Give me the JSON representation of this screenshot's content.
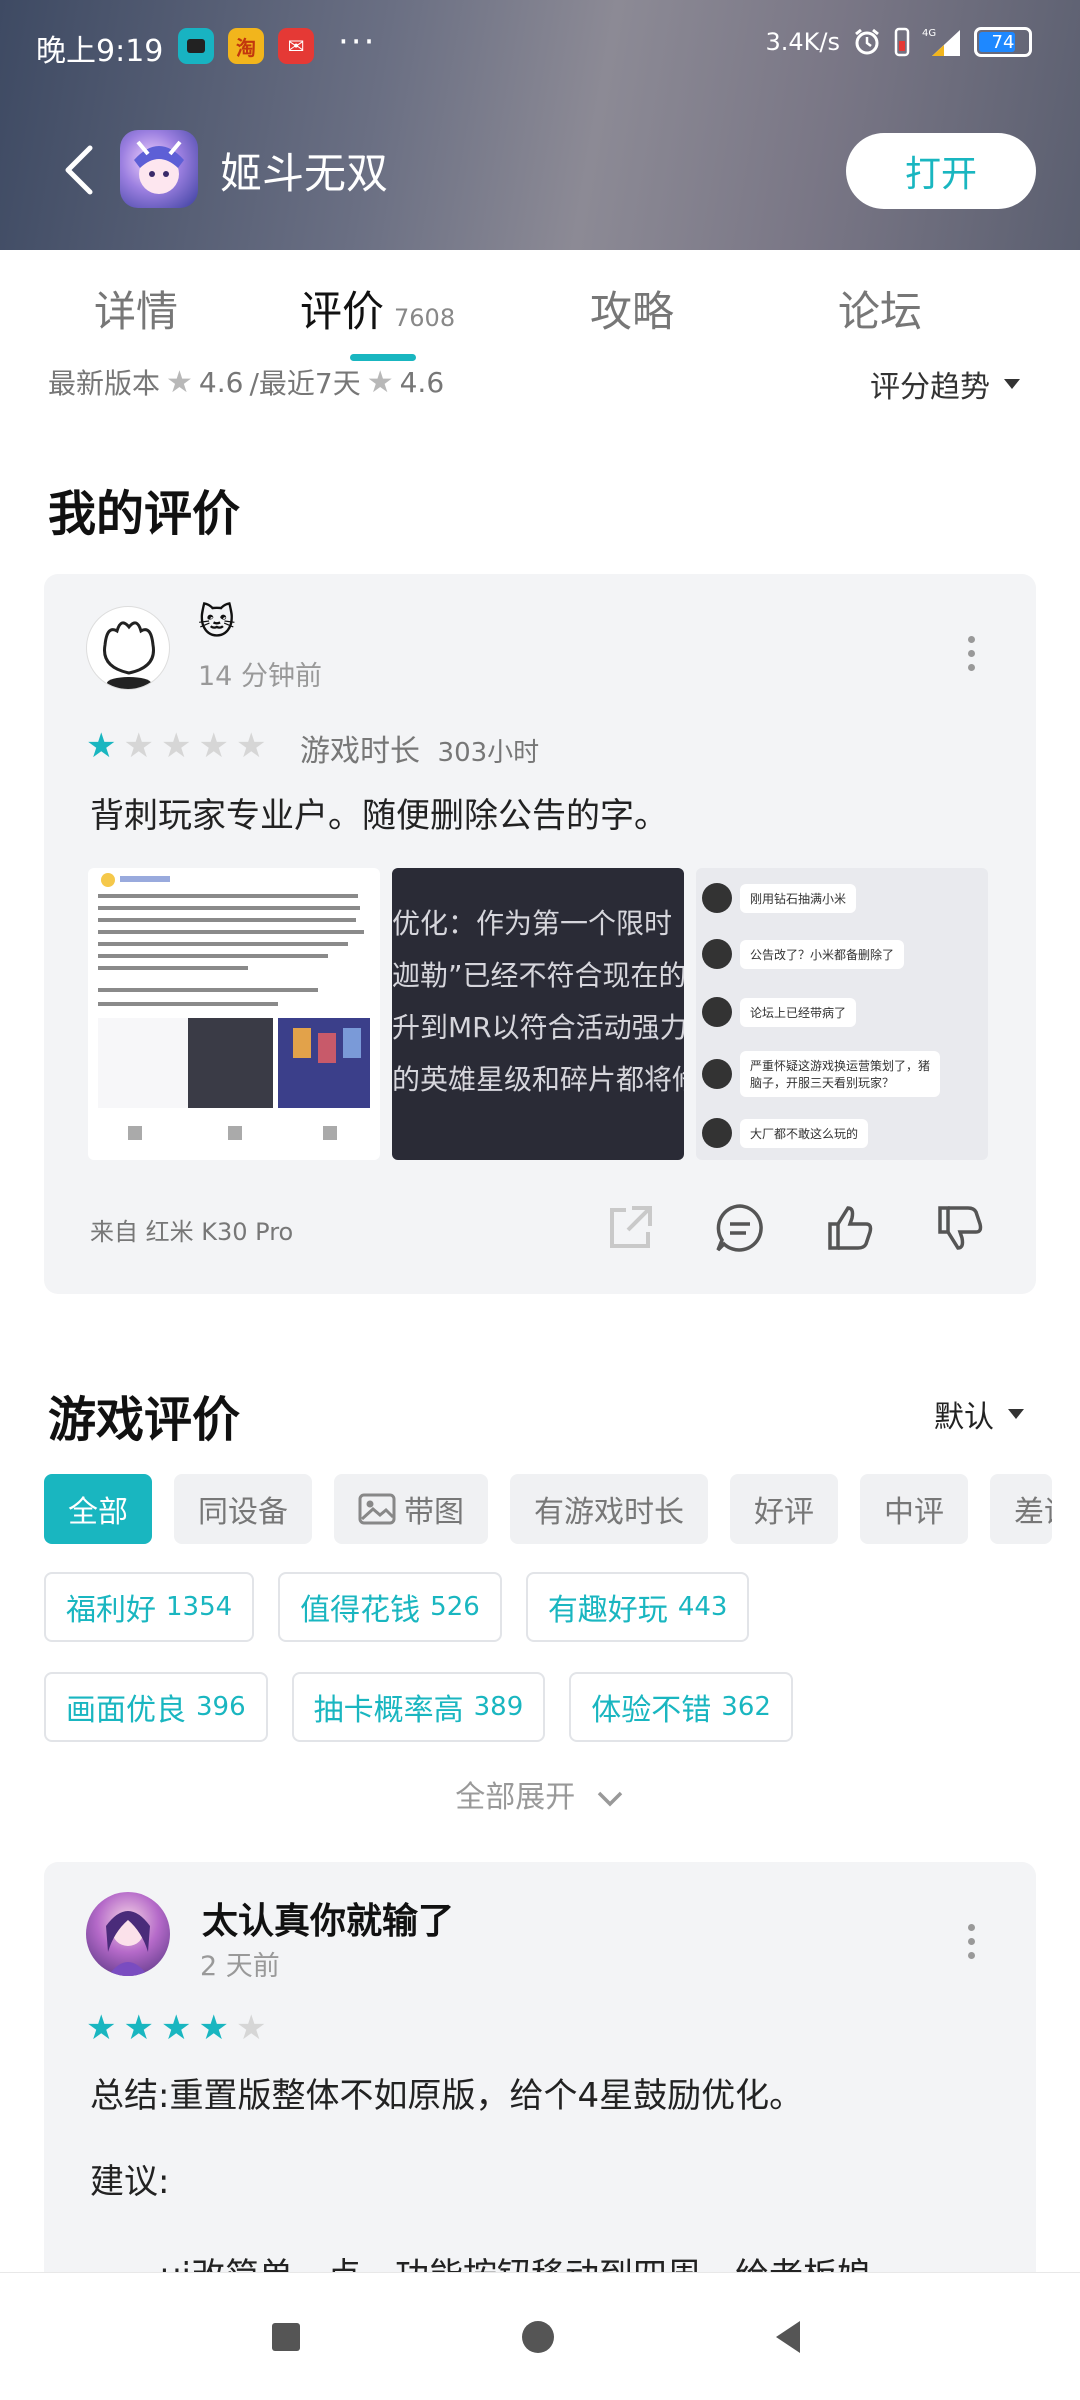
{
  "status": {
    "time": "晚上9:19",
    "apps": [
      {
        "icon": "chat-app-icon",
        "color": "#18b3c2",
        "glyph": "▣"
      },
      {
        "icon": "taobao-app-icon",
        "color": "#f2b51c",
        "glyph": "淘"
      },
      {
        "icon": "mail-app-icon",
        "color": "#e53935",
        "glyph": "✉"
      }
    ],
    "more": "···",
    "speed": "3.4K/s",
    "battery": "74"
  },
  "app": {
    "name": "姬斗无双",
    "open_label": "打开"
  },
  "tabs": [
    {
      "label": "详情",
      "count": ""
    },
    {
      "label": "评价",
      "count": "7608"
    },
    {
      "label": "攻略",
      "count": ""
    },
    {
      "label": "论坛",
      "count": ""
    }
  ],
  "rating": {
    "latest_label": "最新版本",
    "latest_score": "4.6",
    "recent_label": "/最近7天",
    "recent_score": "4.6",
    "trend_label": "评分趋势"
  },
  "my_review": {
    "section_title": "我的评价",
    "user_name": "🐱",
    "time_ago": "14 分钟前",
    "stars": 1,
    "playtime_label": "游戏时长",
    "playtime_value": "303小时",
    "text": "背刺玩家专业户。随便删除公告的字。",
    "thumb2_lines": [
      "优化：作为第一个限时",
      "迦勒”已经不符合现在的版",
      "升到MR以符合活动强力",
      "的英雄星级和碎片都将修"
    ],
    "thumb3_lines": [
      "刚用钻石抽满小米",
      "公告改了？小米都备删除了",
      "论坛上已经带病了",
      "严重怀疑这游戏换运营策划了，猪脑子，开服三天看别玩家？",
      "大厂都不敢这么玩的"
    ],
    "device": "来自 红米 K30 Pro"
  },
  "game_reviews": {
    "section_title": "游戏评价",
    "sort_label": "默认",
    "filters": [
      "全部",
      "同设备",
      "带图",
      "有游戏时长",
      "好评",
      "中评",
      "差评"
    ],
    "tags_row1": [
      {
        "label": "福利好",
        "count": "1354"
      },
      {
        "label": "值得花钱",
        "count": "526"
      },
      {
        "label": "有趣好玩",
        "count": "443"
      }
    ],
    "tags_row2": [
      {
        "label": "画面优良",
        "count": "396"
      },
      {
        "label": "抽卡概率高",
        "count": "389"
      },
      {
        "label": "体验不错",
        "count": "362"
      }
    ],
    "expand_label": "全部展开"
  },
  "review2": {
    "user_name": "太认真你就输了",
    "time_ago": "2 天前",
    "stars": 4,
    "summary": "总结:重置版整体不如原版，给个4星鼓励优化。",
    "suggestion_label": "建议:",
    "partial_line": "ui改简单一点，功能按钮移动到四周，给老板娘"
  }
}
